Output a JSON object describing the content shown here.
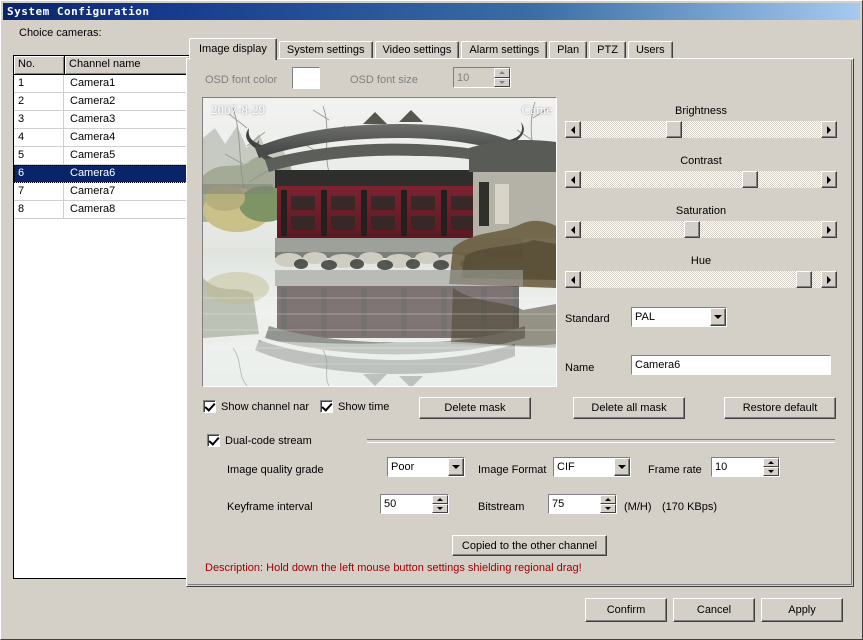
{
  "window": {
    "title": "System Configuration"
  },
  "sidebar": {
    "label": "Choice cameras:",
    "columns": [
      "No.",
      "Channel name"
    ],
    "rows": [
      {
        "no": "1",
        "name": "Camera1"
      },
      {
        "no": "2",
        "name": "Camera2"
      },
      {
        "no": "3",
        "name": "Camera3"
      },
      {
        "no": "4",
        "name": "Camera4"
      },
      {
        "no": "5",
        "name": "Camera5"
      },
      {
        "no": "6",
        "name": "Camera6"
      },
      {
        "no": "7",
        "name": "Camera7"
      },
      {
        "no": "8",
        "name": "Camera8"
      }
    ],
    "selected_index": 5
  },
  "tabs": [
    {
      "label": "Image display",
      "active": true
    },
    {
      "label": "System settings",
      "active": false
    },
    {
      "label": "Video settings",
      "active": false
    },
    {
      "label": "Alarm settings",
      "active": false
    },
    {
      "label": "Plan",
      "active": false
    },
    {
      "label": "PTZ",
      "active": false
    },
    {
      "label": "Users",
      "active": false
    }
  ],
  "osd": {
    "font_color_label": "OSD font color",
    "font_color_value": "#ffffff",
    "font_size_label": "OSD font size",
    "font_size_value": "10",
    "disabled": true
  },
  "preview": {
    "timestamp_overlay": "2007-8-29",
    "channel_overlay": "Came"
  },
  "sliders": [
    {
      "label": "Brightness",
      "percent": 38
    },
    {
      "label": "Contrast",
      "percent": 72
    },
    {
      "label": "Saturation",
      "percent": 46
    },
    {
      "label": "Hue",
      "percent": 96
    }
  ],
  "standard": {
    "label": "Standard",
    "value": "PAL"
  },
  "name": {
    "label": "Name",
    "value": "Camera6"
  },
  "checkboxes": {
    "show_channel_name": {
      "label": "Show channel nar",
      "checked": true
    },
    "show_time": {
      "label": "Show time",
      "checked": true
    },
    "dual_code_stream": {
      "label": "Dual-code stream",
      "checked": true
    }
  },
  "mask_buttons": {
    "delete_mask": "Delete mask",
    "delete_all_mask": "Delete all mask",
    "restore_default": "Restore default"
  },
  "encoding": {
    "image_quality_label": "Image quality grade",
    "image_quality_value": "Poor",
    "image_format_label": "Image Format",
    "image_format_value": "CIF",
    "frame_rate_label": "Frame rate",
    "frame_rate_value": "10",
    "keyframe_label": "Keyframe interval",
    "keyframe_value": "50",
    "bitstream_label": "Bitstream",
    "bitstream_value": "75",
    "bitstream_unit": "(M/H)",
    "bitstream_rate": "(170 KBps)"
  },
  "copy_button": "Copied to the other channel",
  "description": "Description: Hold down the left mouse button settings shielding regional drag!",
  "footer": {
    "confirm": "Confirm",
    "cancel": "Cancel",
    "apply": "Apply"
  },
  "colors": {
    "face": "#d4d0c8",
    "title_start": "#0a246a",
    "title_end": "#a6caf0",
    "selection": "#0a246a",
    "description": "#a00000"
  }
}
